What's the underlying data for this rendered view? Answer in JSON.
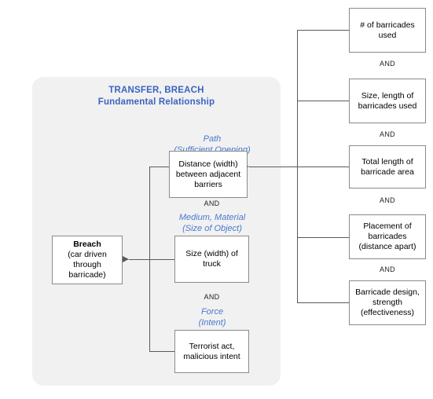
{
  "diagram": {
    "panel_title": {
      "line1": "TRANSFER, BREACH",
      "line2": "Fundamental Relationship"
    },
    "and_label": "AND",
    "outcome_box": {
      "line1": "Breach",
      "line2": "(car driven",
      "line3": "through barricade)"
    },
    "categories": [
      {
        "line1": "Path",
        "line2": "(Sufficient Opening)"
      },
      {
        "line1": "Medium, Material",
        "line2": "(Size of Object)"
      },
      {
        "line1": "Force",
        "line2": "(Intent)"
      }
    ],
    "factor_boxes": [
      {
        "line1": "Distance (width)",
        "line2": "between adjacent",
        "line3": "barriers"
      },
      {
        "line1": "Size (width) of truck",
        "line2": "",
        "line3": ""
      },
      {
        "line1": "Terrorist act,",
        "line2": "malicious intent",
        "line3": ""
      }
    ],
    "right_boxes": [
      {
        "line1": "# of barricades",
        "line2": "used",
        "line3": ""
      },
      {
        "line1": "Size, length of",
        "line2": "barricades used",
        "line3": ""
      },
      {
        "line1": "Total length of",
        "line2": "barricade area",
        "line3": ""
      },
      {
        "line1": "Placement of",
        "line2": "barricades",
        "line3": "(distance apart)"
      },
      {
        "line1": "Barricade design,",
        "line2": "strength",
        "line3": "(effectiveness)"
      }
    ],
    "right_and_labels": [
      "AND",
      "AND",
      "AND",
      "AND"
    ],
    "colors": {
      "panel_bg": "#f1f1f1",
      "title_blue": "#3a63c0",
      "category_blue": "#4a78d0",
      "line_gray": "#5a5a5a",
      "box_border": "#8a8a8a"
    }
  }
}
